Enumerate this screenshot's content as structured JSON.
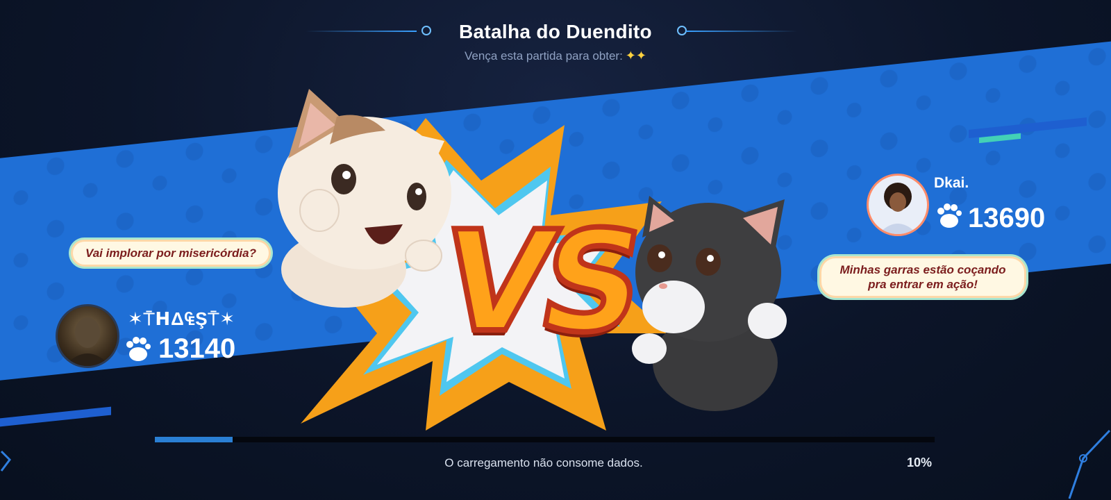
{
  "header": {
    "title": "Batalha do Duendito",
    "subtitle": "Vença esta partida para obter:",
    "subtitle_reward_icon": "sparkle-stars-icon"
  },
  "left_player": {
    "name": "✶⍑ꓧΔ₠Ş⍑✶",
    "score": "13140",
    "taunt": "Vai implorar por misericórdia?",
    "avatar_icon": "dark-warrior-avatar"
  },
  "right_player": {
    "name": "Dkai.",
    "score": "13690",
    "taunt": "Minhas garras estão coçando pra entrar em ação!",
    "avatar_icon": "curly-hair-boy-avatar"
  },
  "versus": {
    "label": "VS"
  },
  "loading": {
    "text": "O carregamento não consome dados.",
    "percent_label": "10%",
    "progress": 0.1
  },
  "colors": {
    "banner_blue": "#1f6fd6",
    "vs_orange": "#ffa21a",
    "progress_blue": "#2a7fd4",
    "bubble_text": "#7b1d1d"
  }
}
